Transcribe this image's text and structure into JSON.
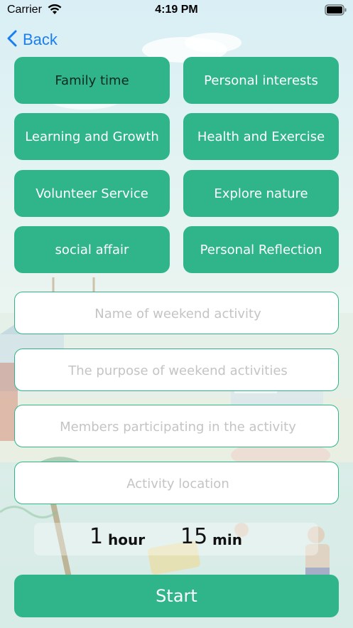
{
  "status_bar": {
    "carrier": "Carrier",
    "time": "4:19 PM"
  },
  "nav": {
    "back_label": "Back"
  },
  "categories": [
    {
      "label": "Family time",
      "selected": true
    },
    {
      "label": "Personal interests",
      "selected": false
    },
    {
      "label": "Learning and Growth",
      "selected": false
    },
    {
      "label": "Health and Exercise",
      "selected": false
    },
    {
      "label": "Volunteer Service",
      "selected": false
    },
    {
      "label": "Explore nature",
      "selected": false
    },
    {
      "label": "social affair",
      "selected": false
    },
    {
      "label": "Personal Reflection",
      "selected": false
    }
  ],
  "form": {
    "name": {
      "value": "",
      "placeholder": "Name of weekend activity"
    },
    "purpose": {
      "value": "",
      "placeholder": "The purpose of weekend activities"
    },
    "members": {
      "value": "",
      "placeholder": "Members participating in the activity"
    },
    "location": {
      "value": "",
      "placeholder": "Activity location"
    }
  },
  "duration": {
    "hours": "1",
    "hour_unit": "hour",
    "minutes": "15",
    "min_unit": "min"
  },
  "start_label": "Start",
  "colors": {
    "accent": "#2fb589",
    "link": "#1a7ef2",
    "placeholder": "#c4c4c4"
  }
}
